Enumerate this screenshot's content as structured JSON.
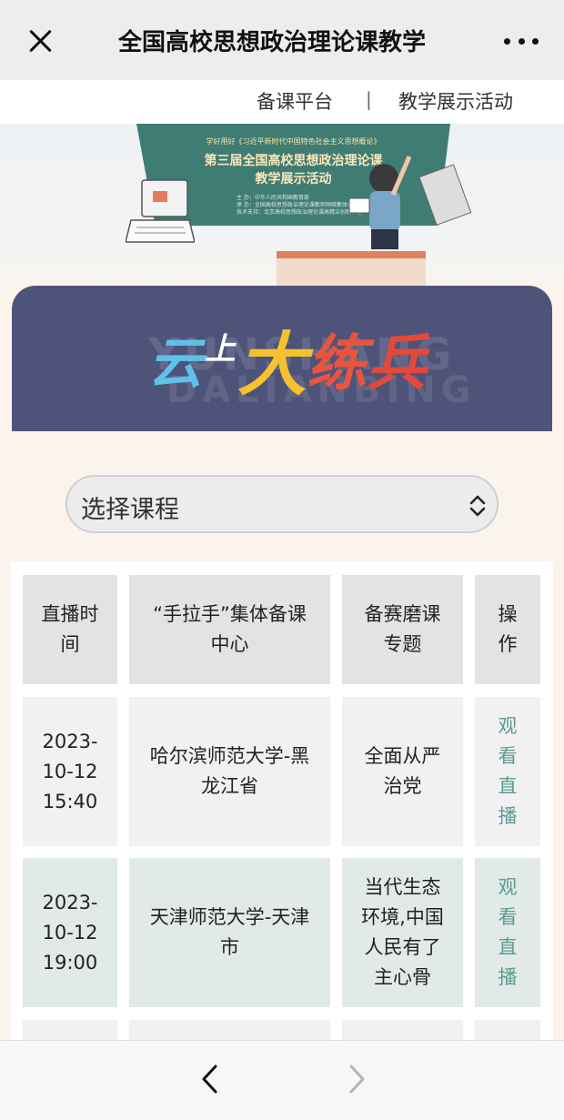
{
  "header": {
    "title": "全国高校思想政治理论课教学",
    "close_icon": "close-icon",
    "more_icon": "more-dots-icon"
  },
  "subnav": {
    "items": [
      "备课平台",
      "教学展示活动"
    ],
    "separator": "|"
  },
  "banner": {
    "subtitle": "学好用好《习近平新时代中国特色社会主义思想概论》",
    "title_line1": "第三届全国高校思想政治理论课",
    "title_line2": "教学展示活动",
    "credits": [
      "主  办：中华人民共和国教育部",
      "承  办：全国高校思想政治理论课教师网络集体备课平台",
      "技术支持：北京高校思想政治理论课高精尖创新中心"
    ]
  },
  "cloud_section": {
    "logo_chars": [
      "云",
      "上",
      "大",
      "练",
      "兵"
    ],
    "bg_text_line1": "YUNSHANG",
    "bg_text_line2": "DALIANBING"
  },
  "course_select": {
    "label": "选择课程",
    "icon": "select-updown-icon"
  },
  "table": {
    "headers": [
      [
        "直播时",
        "间"
      ],
      [
        "“手拉手”集体备课",
        "中心"
      ],
      [
        "备赛磨课",
        "专题"
      ],
      [
        "操",
        "作"
      ]
    ],
    "rows": [
      {
        "time": [
          "2023-",
          "10-12",
          "15:40"
        ],
        "center": [
          "哈尔滨师范大学-黑",
          "龙江省"
        ],
        "topic": [
          "全面从严",
          "治党"
        ],
        "action": [
          "观",
          "看",
          "直",
          "播"
        ]
      },
      {
        "time": [
          "2023-",
          "10-12",
          "19:00"
        ],
        "center": [
          "天津师范大学-天津",
          "市"
        ],
        "topic": [
          "当代生态",
          "环境,中国",
          "人民有了",
          "主心骨"
        ],
        "action": [
          "观",
          "看",
          "直",
          "播"
        ]
      }
    ]
  },
  "colors": {
    "topbar_bg": "#ededed",
    "page_bg": "#fbf4ec",
    "cloud_card_bg": "#4e5379",
    "accent_link": "#5c9b96",
    "row_alt_bg": "#e1eae6"
  },
  "bottom_nav": {
    "back_icon": "chevron-left-icon",
    "forward_icon": "chevron-right-icon"
  }
}
